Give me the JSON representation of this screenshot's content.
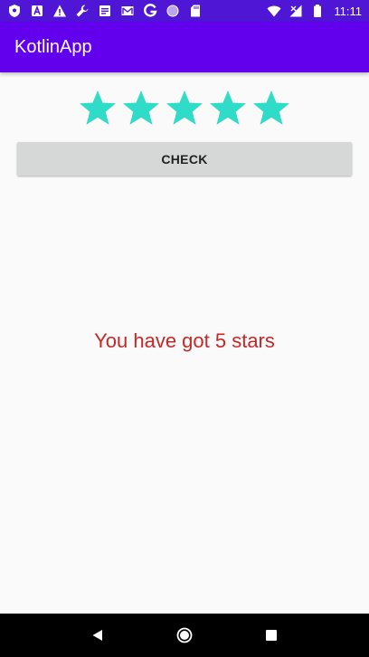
{
  "status_bar": {
    "time": "11:11",
    "left_icons": [
      "shield-icon",
      "a-box-icon",
      "warning-icon",
      "wrench-icon",
      "note-icon",
      "mail-icon",
      "g-icon",
      "circle-icon",
      "sd-card-icon"
    ],
    "right_icons": [
      "wifi-icon",
      "signal-icon",
      "battery-icon"
    ]
  },
  "app_bar": {
    "title": "KotlinApp"
  },
  "rating": {
    "value": 5,
    "max": 5,
    "filled_color": "#2fdcc7"
  },
  "check_button": {
    "label": "CHECK"
  },
  "result": {
    "text": "You have got 5 stars",
    "color": "#c62828"
  },
  "nav_bar": {
    "buttons": [
      "back-icon",
      "home-icon",
      "recents-icon"
    ]
  },
  "colors": {
    "status_bar": "#4f16d6",
    "app_bar": "#6200ee",
    "background": "#fafafa"
  }
}
